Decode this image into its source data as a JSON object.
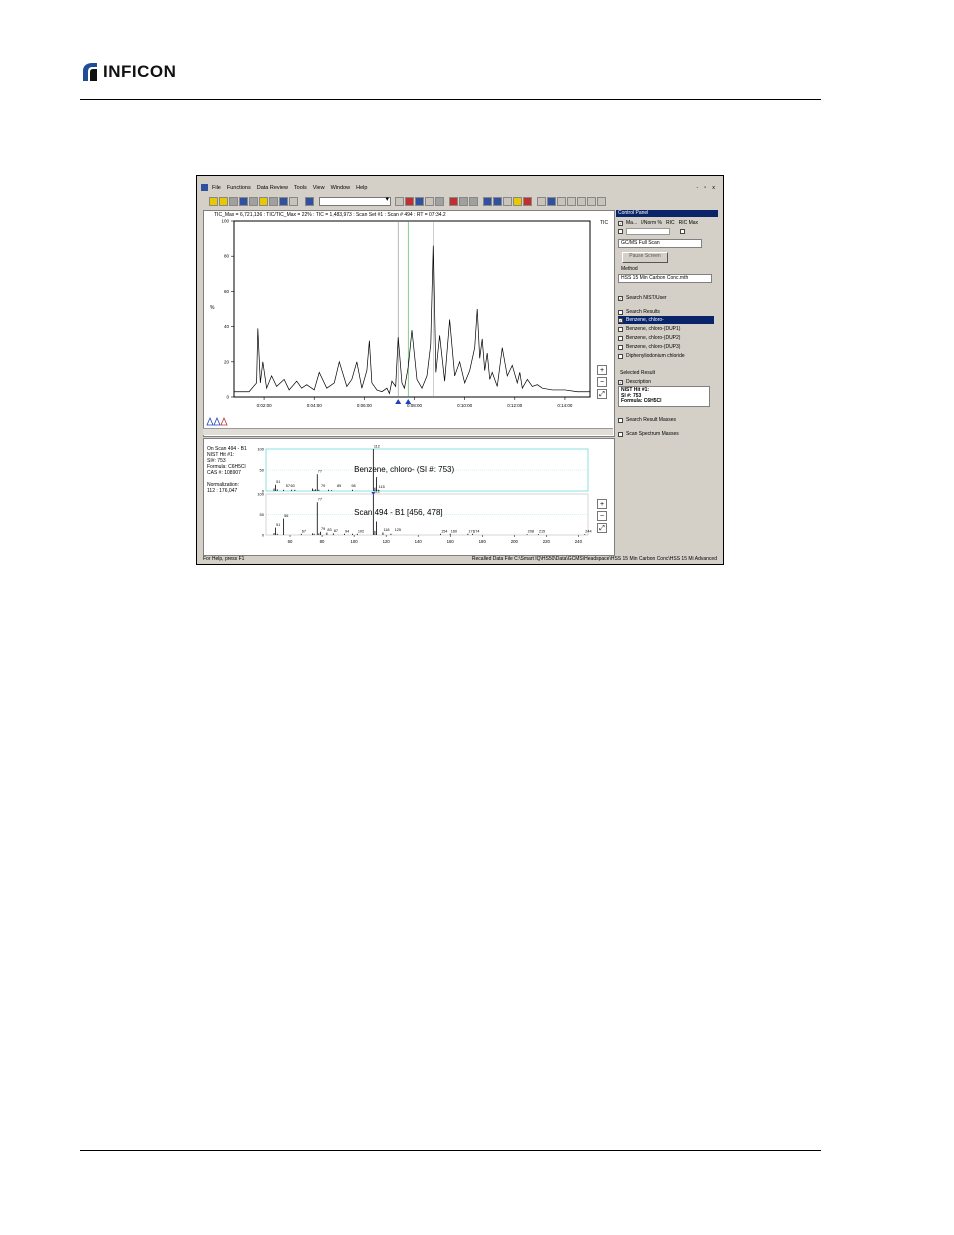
{
  "page": {
    "logo_text": "INFICON",
    "logo_mark": "inficon-logo-mark"
  },
  "app": {
    "menu": [
      "File",
      "Functions",
      "Data Review",
      "Tools",
      "View",
      "Window",
      "Help"
    ],
    "window_controls": [
      "-",
      "▫",
      "x"
    ],
    "tic_header": "TIC_Max = 6,721,136 : TIC/TIC_Max = 22% : TIC = 1,483,973 : Scan Set #1 : Scan #   494 : RT = 07:34.2",
    "tic_trace_label": "TIC",
    "status_left": "For Help, press F1",
    "status_right": "Recalled Data File C:\\Smart IQ\\HS50\\Data\\GCMS\\Headspace\\HSS 15 Min Carbon Conc\\HSS 15 Mi Advanced"
  },
  "chart_data": [
    {
      "type": "line",
      "name_key": "tic",
      "y_label": "%",
      "y_ticks": [
        0,
        20,
        40,
        60,
        80,
        100
      ],
      "x_ticks": [
        "0:02:00",
        "0:04:00",
        "0:06:00",
        "0:08:00",
        "0:10:00",
        "0:12:00",
        "0:14:00"
      ],
      "x_range_min": [
        0.8,
        15.0
      ],
      "ylim": [
        0,
        100
      ],
      "x": [
        0.8,
        1.4,
        1.7,
        1.75,
        1.85,
        1.95,
        2.1,
        2.3,
        2.5,
        2.8,
        3.0,
        3.3,
        3.5,
        3.7,
        4.0,
        4.2,
        4.5,
        4.8,
        5.0,
        5.3,
        5.5,
        5.7,
        5.9,
        6.1,
        6.2,
        6.3,
        6.5,
        6.7,
        6.9,
        7.0,
        7.1,
        7.25,
        7.35,
        7.5,
        7.6,
        7.75,
        7.9,
        8.1,
        8.3,
        8.5,
        8.65,
        8.75,
        8.85,
        9.0,
        9.2,
        9.4,
        9.6,
        9.8,
        10.0,
        10.2,
        10.4,
        10.5,
        10.6,
        10.7,
        10.8,
        10.9,
        11.0,
        11.1,
        11.3,
        11.5,
        11.7,
        11.9,
        12.1,
        12.2,
        12.3,
        12.5,
        12.7,
        12.9,
        13.1,
        13.5,
        14.0,
        14.5,
        15.0
      ],
      "y": [
        3,
        3,
        8,
        39,
        8,
        20,
        5,
        12,
        6,
        10,
        4,
        9,
        5,
        7,
        4,
        14,
        5,
        8,
        20,
        6,
        10,
        20,
        5,
        15,
        32,
        8,
        4,
        3,
        5,
        2,
        9,
        6,
        34,
        8,
        5,
        17,
        38,
        10,
        5,
        12,
        30,
        86,
        14,
        35,
        9,
        44,
        12,
        20,
        8,
        15,
        28,
        50,
        22,
        33,
        15,
        25,
        10,
        14,
        6,
        28,
        12,
        18,
        8,
        14,
        5,
        10,
        6,
        7,
        5,
        4,
        4,
        3,
        3
      ]
    },
    {
      "type": "bar",
      "name_key": "library",
      "title": "Benzene, chloro- (SI #: 753)",
      "y_ticks": [
        0,
        50,
        100
      ],
      "x_ticks": [
        60,
        80,
        100,
        120,
        140,
        160,
        180,
        200,
        220,
        240
      ],
      "x_range": [
        45,
        246
      ],
      "x": [
        50,
        51,
        52,
        56,
        61,
        63,
        74,
        75,
        76,
        77,
        78,
        84,
        86,
        99,
        112,
        113,
        114,
        115
      ],
      "values": [
        6,
        15,
        4,
        3,
        3,
        3,
        6,
        3,
        4,
        40,
        3,
        3,
        2,
        3,
        100,
        8,
        33,
        3
      ],
      "labels": [
        "51",
        "57",
        "60",
        "77",
        "79",
        "89",
        "98",
        "112",
        "115"
      ],
      "label_x": [
        51,
        57,
        60,
        77,
        79,
        89,
        98,
        112,
        115
      ]
    },
    {
      "type": "bar",
      "name_key": "scan",
      "title": "Scan 494  - B1 [456, 478]",
      "y_ticks": [
        0,
        50,
        100
      ],
      "x_ticks": [
        60,
        80,
        100,
        120,
        140,
        160,
        180,
        200,
        220,
        240
      ],
      "x_range": [
        45,
        246
      ],
      "x": [
        50,
        51,
        52,
        56,
        67,
        74,
        75,
        77,
        78,
        79,
        83,
        87,
        94,
        99,
        102,
        112,
        113,
        114,
        118,
        123,
        154,
        160,
        171,
        174,
        208,
        215,
        244
      ],
      "values": [
        5,
        18,
        3,
        40,
        3,
        4,
        3,
        80,
        4,
        8,
        6,
        4,
        3,
        3,
        3,
        100,
        10,
        33,
        6,
        3,
        3,
        3,
        3,
        3,
        2,
        2,
        2
      ],
      "labels": [
        "51",
        "56",
        "67",
        "77",
        "79",
        "83",
        "87",
        "94",
        "102",
        "112",
        "118",
        "125",
        "154",
        "160",
        "171",
        "174",
        "208",
        "215",
        "244"
      ],
      "label_x": [
        51,
        56,
        67,
        77,
        79,
        83,
        87,
        94,
        102,
        112,
        118,
        125,
        154,
        160,
        171,
        174,
        208,
        215,
        244
      ]
    }
  ],
  "spectrum_info": {
    "lines": [
      "On Scan 494 - B1",
      "NIST Hit #1:",
      "SI#: 753",
      "Formula: C6H5Cl",
      "CAS #: 108907",
      "",
      "Normalization:",
      " 112 : 176,047"
    ]
  },
  "control_panel": {
    "title": "Control Panel",
    "columns": [
      "Ma...",
      "I/Norm %",
      "RIC",
      "RIC Max"
    ],
    "scan_mode": "GC/MS Full Scan",
    "pause_label": "Pause Screen",
    "method_label": "Method",
    "method_value": "HSS 15 Min Carbon Conc.mth",
    "search_nist": "Search NIST/User",
    "search_results_label": "Search Results",
    "hits": [
      "Benzene, chloro-",
      "Benzene, chloro-(DUP1)",
      "Benzene, chloro-(DUP2)",
      "Benzene, chloro-(DUP3)",
      "Diphenyliodonium chloride"
    ],
    "selected_result_label": "Selected Result",
    "description_label": "Description",
    "description_lines": [
      "NIST Hit #1:",
      "SI #: 753",
      "Formula: C6H5Cl"
    ],
    "search_result_masses": "Search Result Masses",
    "scan_spectrum_masses": "Scan Spectrum Masses"
  }
}
